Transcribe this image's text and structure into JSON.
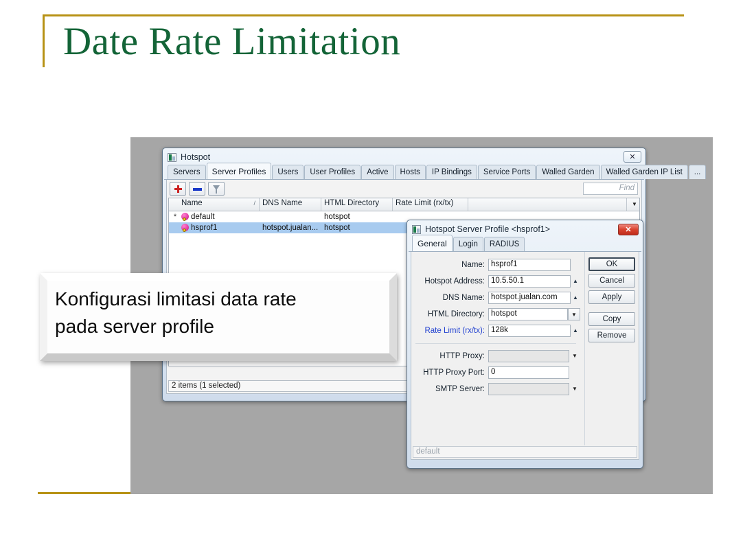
{
  "slide": {
    "title": "Date Rate Limitation",
    "accent_color": "#b79215",
    "title_color": "#136437"
  },
  "callout": {
    "line1": "Konfigurasi limitasi data rate",
    "line2": "pada server profile"
  },
  "hotspot_window": {
    "title": "Hotspot",
    "close_label": "✕",
    "tabs": [
      {
        "label": "Servers",
        "active": false
      },
      {
        "label": "Server Profiles",
        "active": true
      },
      {
        "label": "Users",
        "active": false
      },
      {
        "label": "User Profiles",
        "active": false
      },
      {
        "label": "Active",
        "active": false
      },
      {
        "label": "Hosts",
        "active": false
      },
      {
        "label": "IP Bindings",
        "active": false
      },
      {
        "label": "Service Ports",
        "active": false
      },
      {
        "label": "Walled Garden",
        "active": false
      },
      {
        "label": "Walled Garden IP List",
        "active": false
      },
      {
        "label": "...",
        "active": false
      }
    ],
    "toolbar": {
      "add_icon": "plus-icon",
      "remove_icon": "minus-icon",
      "filter_icon": "funnel-icon",
      "find_placeholder": "Find"
    },
    "table": {
      "columns": [
        "Name",
        "DNS Name",
        "HTML Directory",
        "Rate Limit (rx/tx)"
      ],
      "sort_indicator": "/",
      "menu_caret": "▼",
      "rows": [
        {
          "marker": "*",
          "icon": "profile-globe-key-icon",
          "name": "default",
          "dns_name": "",
          "html_directory": "hotspot",
          "rate_limit": "",
          "selected": false
        },
        {
          "marker": "",
          "icon": "profile-globe-key-icon",
          "name": "hsprof1",
          "dns_name": "hotspot.jualan...",
          "html_directory": "hotspot",
          "rate_limit": "",
          "selected": true
        }
      ]
    },
    "status": "2 items (1 selected)"
  },
  "profile_dialog": {
    "title": "Hotspot Server Profile <hsprof1>",
    "close_label": "✕",
    "tabs": [
      {
        "label": "General",
        "active": true
      },
      {
        "label": "Login",
        "active": false
      },
      {
        "label": "RADIUS",
        "active": false
      }
    ],
    "fields": {
      "name": {
        "label": "Name:",
        "value": "hsprof1"
      },
      "hotspot_address": {
        "label": "Hotspot Address:",
        "value": "10.5.50.1",
        "spinner": "▲"
      },
      "dns_name": {
        "label": "DNS Name:",
        "value": "hotspot.jualan.com",
        "spinner": "▲"
      },
      "html_directory": {
        "label": "HTML Directory:",
        "value": "hotspot",
        "spinner": "▼"
      },
      "rate_limit": {
        "label": "Rate Limit (rx/tx):",
        "value": "128k",
        "spinner": "▲",
        "highlight_color": "#1f3fd0"
      },
      "http_proxy": {
        "label": "HTTP Proxy:",
        "value": "",
        "caret": "▼"
      },
      "http_proxy_port": {
        "label": "HTTP Proxy Port:",
        "value": "0"
      },
      "smtp_server": {
        "label": "SMTP Server:",
        "value": "",
        "caret": "▼"
      }
    },
    "buttons": [
      "OK",
      "Cancel",
      "Apply",
      "Copy",
      "Remove"
    ],
    "status": "default"
  }
}
